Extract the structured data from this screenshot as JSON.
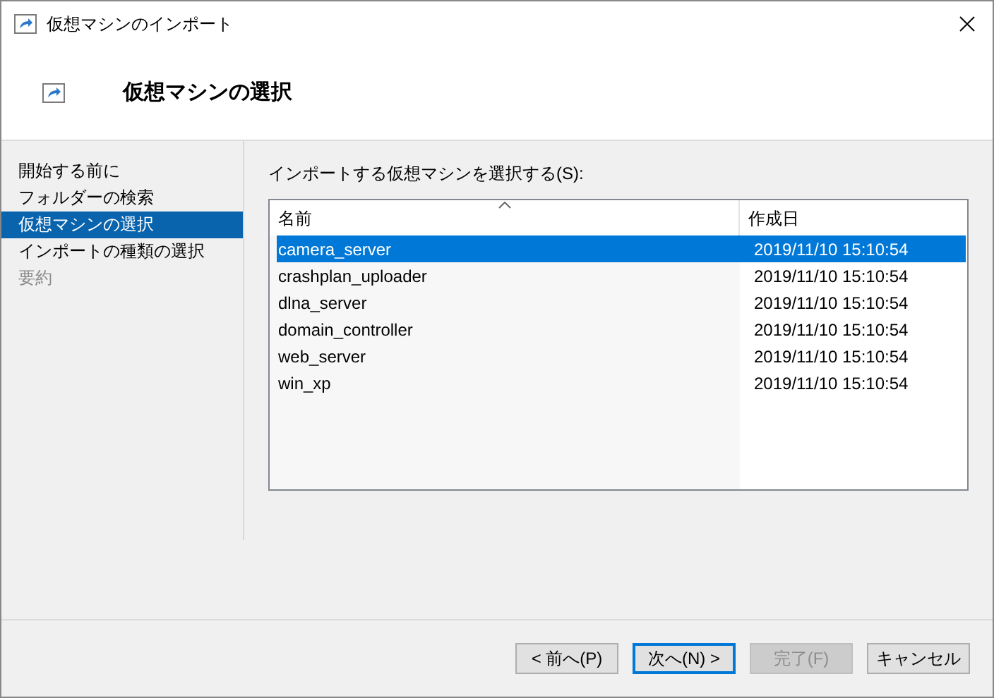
{
  "window": {
    "title": "仮想マシンのインポート"
  },
  "header": {
    "title": "仮想マシンの選択"
  },
  "sidebar": {
    "items": [
      {
        "label": "開始する前に",
        "selected": false,
        "disabled": false
      },
      {
        "label": "フォルダーの検索",
        "selected": false,
        "disabled": false
      },
      {
        "label": "仮想マシンの選択",
        "selected": true,
        "disabled": false
      },
      {
        "label": "インポートの種類の選択",
        "selected": false,
        "disabled": false
      },
      {
        "label": "要約",
        "selected": false,
        "disabled": true
      }
    ]
  },
  "prompt": "インポートする仮想マシンを選択する(S):",
  "table": {
    "columns": [
      {
        "label": "名前",
        "sorted": true
      },
      {
        "label": "作成日",
        "sorted": false
      }
    ],
    "rows": [
      {
        "name": "camera_server",
        "created": "2019/11/10 15:10:54",
        "selected": true
      },
      {
        "name": "crashplan_uploader",
        "created": "2019/11/10 15:10:54",
        "selected": false
      },
      {
        "name": "dlna_server",
        "created": "2019/11/10 15:10:54",
        "selected": false
      },
      {
        "name": "domain_controller",
        "created": "2019/11/10 15:10:54",
        "selected": false
      },
      {
        "name": "web_server",
        "created": "2019/11/10 15:10:54",
        "selected": false
      },
      {
        "name": "win_xp",
        "created": "2019/11/10 15:10:54",
        "selected": false
      }
    ]
  },
  "buttons": [
    {
      "label": "< 前へ(P)",
      "default": false,
      "disabled": false
    },
    {
      "label": "次へ(N) >",
      "default": true,
      "disabled": false
    },
    {
      "label": "完了(F)",
      "default": false,
      "disabled": true
    },
    {
      "label": "キャンセル",
      "default": false,
      "disabled": false
    }
  ]
}
